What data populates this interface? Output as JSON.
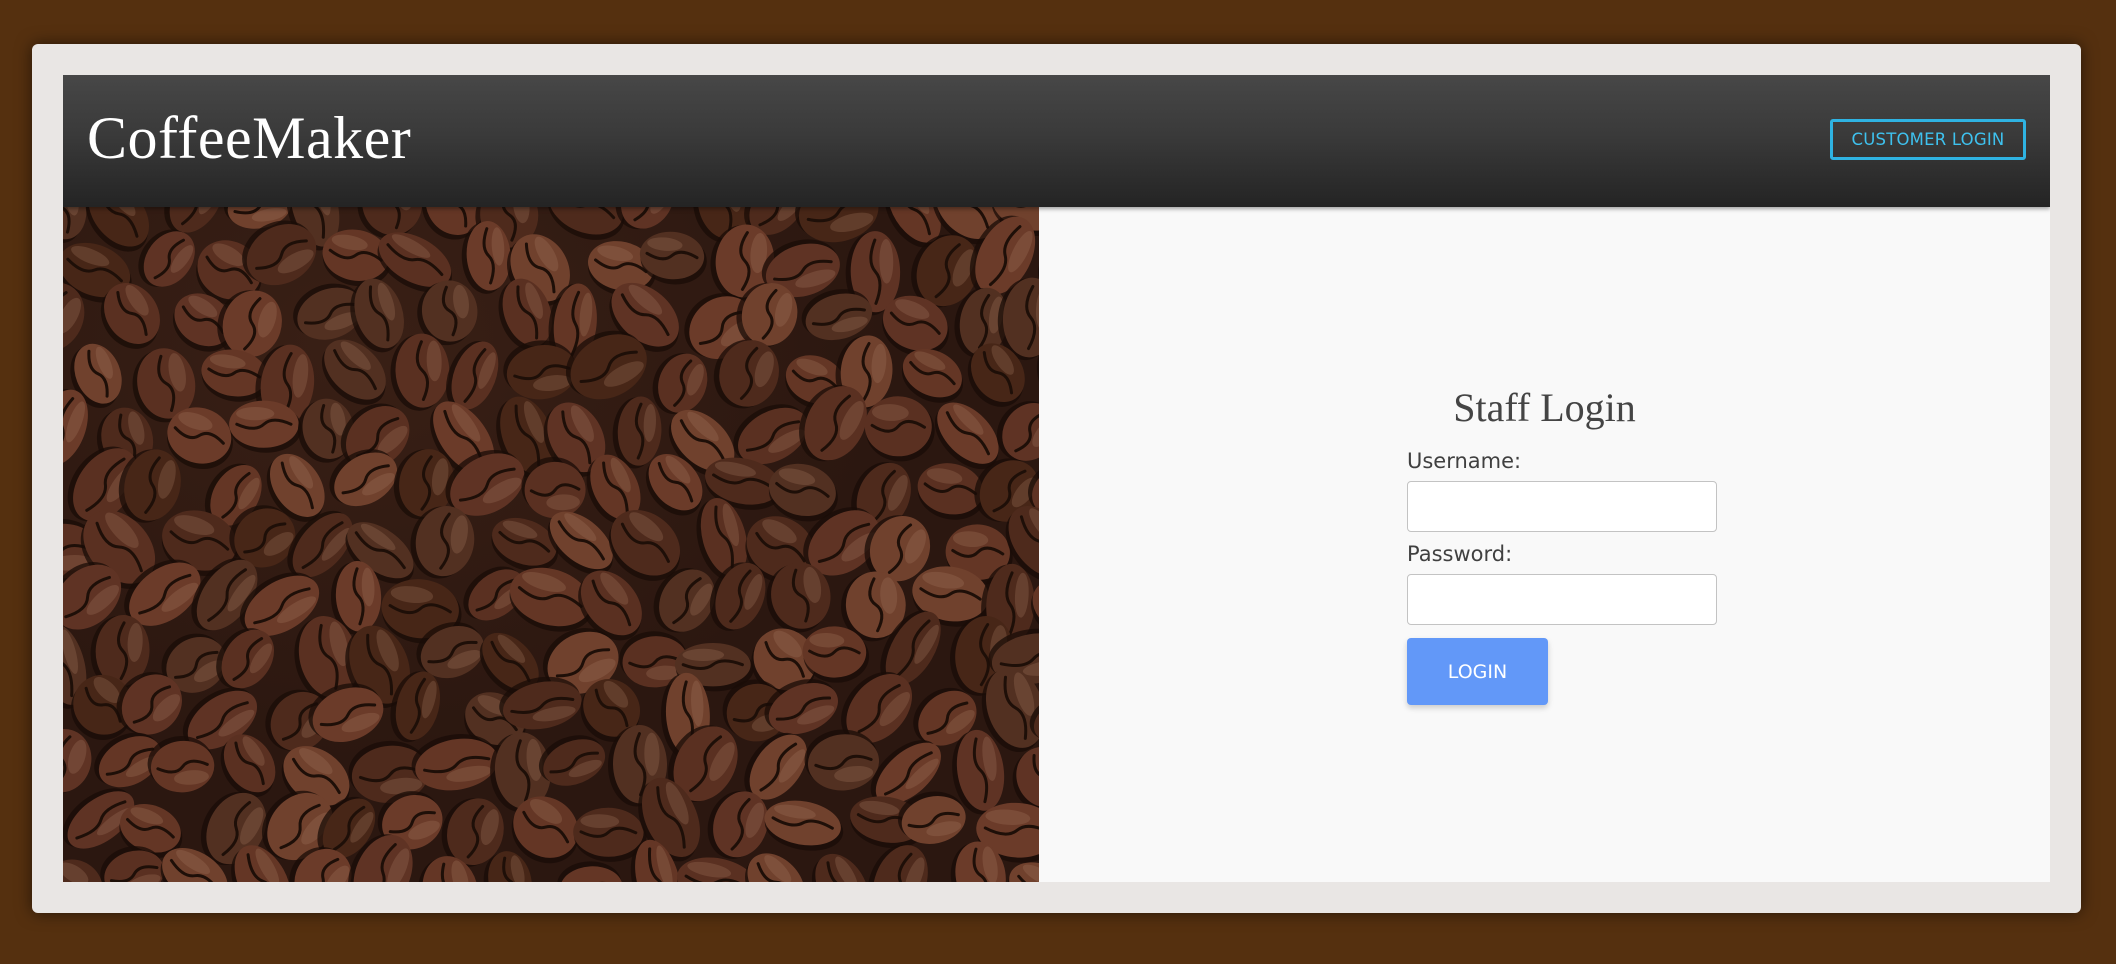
{
  "header": {
    "brand": "CoffeeMaker",
    "customer_login_label": "CUSTOMER LOGIN"
  },
  "hero_image": {
    "subject": "roasted coffee beans"
  },
  "login": {
    "title": "Staff Login",
    "username_label": "Username:",
    "username_value": "",
    "password_label": "Password:",
    "password_value": "",
    "submit_label": "LOGIN"
  },
  "colors": {
    "page_background": "#55300f",
    "frame": "#e9e6e4",
    "header": "#3a3a3a",
    "accent_outline": "#2fb3e2",
    "login_button": "#6298f8"
  }
}
